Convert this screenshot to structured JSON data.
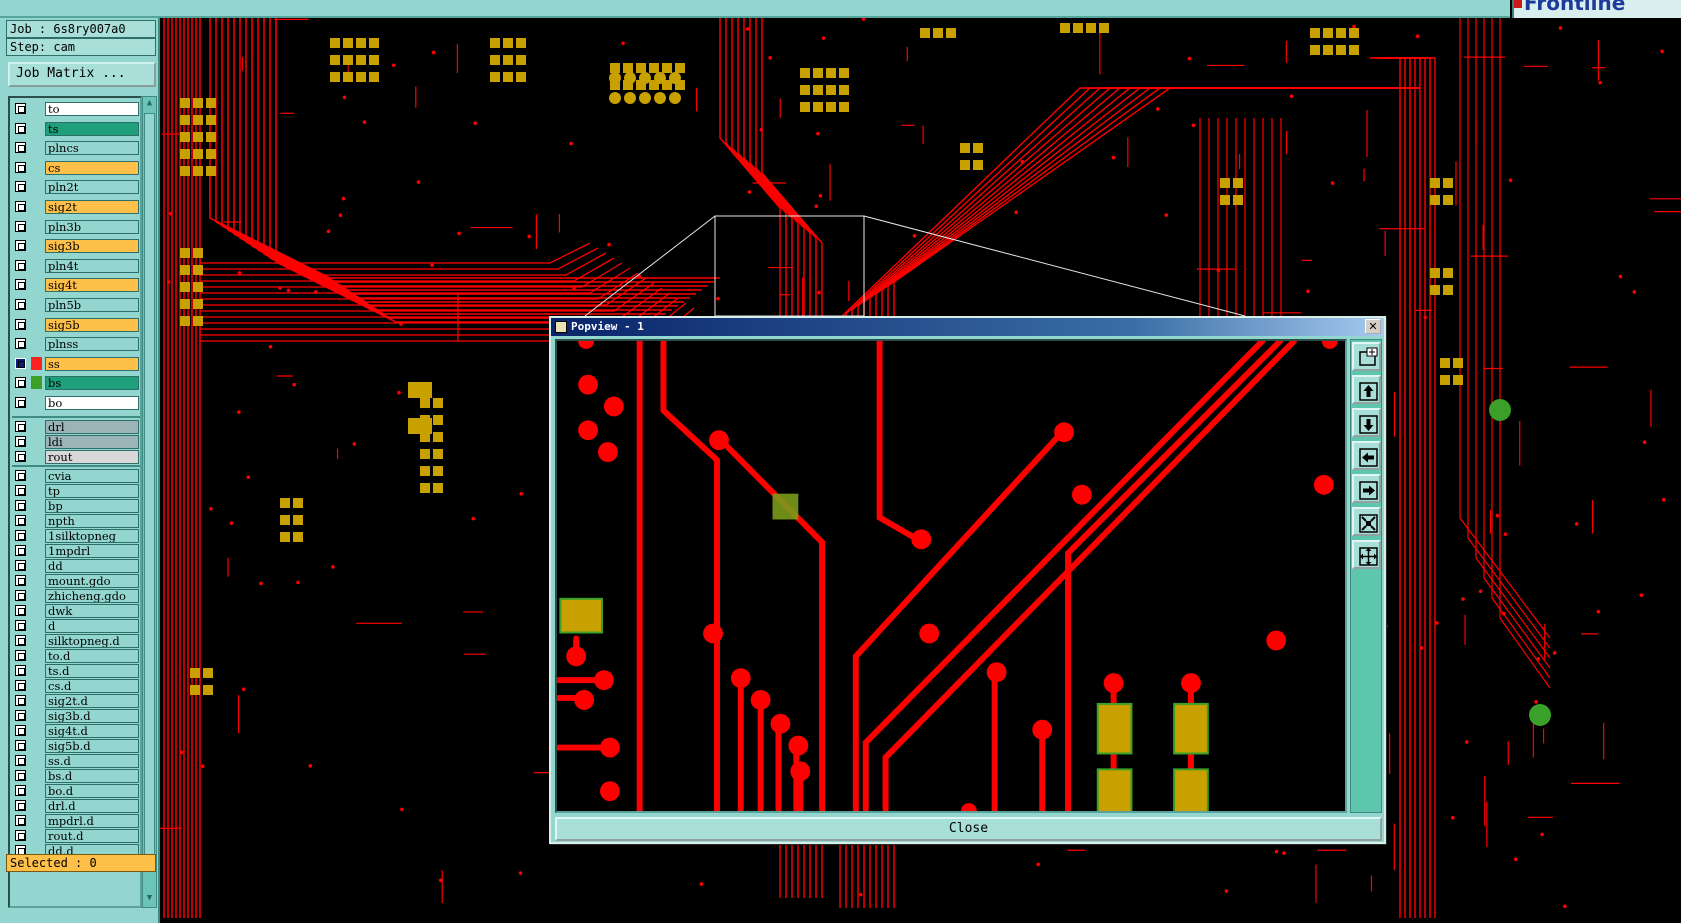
{
  "top": {
    "brand_text": "Frontline"
  },
  "job_info": {
    "job_line": "Job : 6s8ry007a0",
    "step_line": "Step: cam"
  },
  "job_matrix_label": "Job Matrix ...",
  "layers": [
    {
      "name": "to",
      "color": "#ffffff"
    },
    {
      "name": "ts",
      "color": "#1fa07a"
    },
    {
      "name": "plncs",
      "color": "#93d6cf"
    },
    {
      "name": "cs",
      "color": "#ffc04a"
    },
    {
      "name": "pln2t",
      "color": "#93d6cf"
    },
    {
      "name": "sig2t",
      "color": "#ffc04a"
    },
    {
      "name": "pln3b",
      "color": "#93d6cf"
    },
    {
      "name": "sig3b",
      "color": "#ffc04a"
    },
    {
      "name": "pln4t",
      "color": "#93d6cf"
    },
    {
      "name": "sig4t",
      "color": "#ffc04a"
    },
    {
      "name": "pln5b",
      "color": "#93d6cf"
    },
    {
      "name": "sig5b",
      "color": "#ffc04a"
    },
    {
      "name": "plnss",
      "color": "#93d6cf"
    },
    {
      "name": "ss",
      "color": "#ffc04a",
      "active": true
    },
    {
      "name": "bs",
      "color": "#1fa07a"
    },
    {
      "name": "bo",
      "color": "#ffffff"
    },
    {
      "name": "drl",
      "color": "#9ab4b7"
    },
    {
      "name": "ldi",
      "color": "#9ab4b7"
    },
    {
      "name": "rout",
      "color": "#d8d8d8"
    },
    {
      "name": "cvia",
      "color": "#93d6cf"
    },
    {
      "name": "tp",
      "color": "#93d6cf"
    },
    {
      "name": "bp",
      "color": "#93d6cf"
    },
    {
      "name": "npth",
      "color": "#93d6cf"
    },
    {
      "name": "1silktopneg",
      "color": "#93d6cf"
    },
    {
      "name": "1mpdrl",
      "color": "#93d6cf"
    },
    {
      "name": "dd",
      "color": "#93d6cf"
    },
    {
      "name": "mount.gdo",
      "color": "#93d6cf"
    },
    {
      "name": "zhicheng.gdo",
      "color": "#93d6cf"
    },
    {
      "name": "dwk",
      "color": "#93d6cf"
    },
    {
      "name": "d",
      "color": "#93d6cf"
    },
    {
      "name": "silktopneg.d",
      "color": "#93d6cf"
    },
    {
      "name": "to.d",
      "color": "#93d6cf"
    },
    {
      "name": "ts.d",
      "color": "#93d6cf"
    },
    {
      "name": "cs.d",
      "color": "#93d6cf"
    },
    {
      "name": "sig2t.d",
      "color": "#93d6cf"
    },
    {
      "name": "sig3b.d",
      "color": "#93d6cf"
    },
    {
      "name": "sig4t.d",
      "color": "#93d6cf"
    },
    {
      "name": "sig5b.d",
      "color": "#93d6cf"
    },
    {
      "name": "ss.d",
      "color": "#93d6cf"
    },
    {
      "name": "bs.d",
      "color": "#93d6cf"
    },
    {
      "name": "bo.d",
      "color": "#93d6cf"
    },
    {
      "name": "drl.d",
      "color": "#93d6cf"
    },
    {
      "name": "mpdrl.d",
      "color": "#93d6cf"
    },
    {
      "name": "rout.d",
      "color": "#93d6cf"
    },
    {
      "name": "dd.d",
      "color": "#93d6cf"
    }
  ],
  "selected_label": "Selected : 0",
  "popview": {
    "title": "Popview - 1",
    "close_label": "Close",
    "toolbar_icons": [
      "zoom-in-icon",
      "move-up-icon",
      "move-down-icon",
      "move-left-icon",
      "move-right-icon",
      "zoom-fit-icon",
      "zoom-home-icon"
    ]
  },
  "colors": {
    "trace": "#ff0000",
    "pad": "#c8a000",
    "pad_green": "#3aa02a",
    "panel": "#93d6cf",
    "highlight": "#ffc04a"
  }
}
